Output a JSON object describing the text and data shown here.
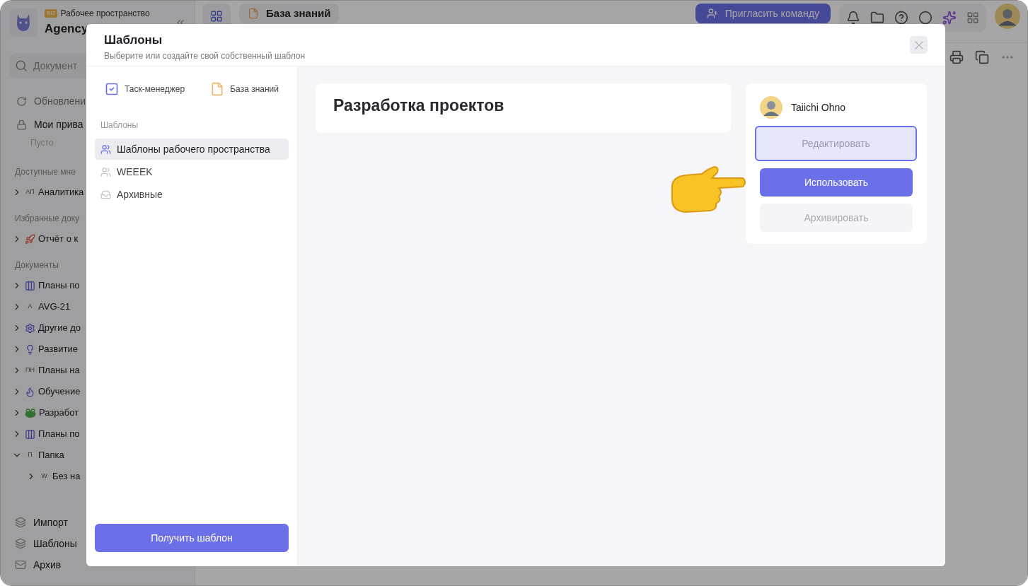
{
  "workspace": {
    "badge": "BIZ",
    "label": "Рабочее пространство",
    "name": "Agency"
  },
  "breadcrumb": {
    "title": "База знаний"
  },
  "invite_button": "Пригласить команду",
  "search": {
    "placeholder": "Документ"
  },
  "sidebar": {
    "top_items": [
      {
        "label": "Обновлени",
        "kind": "updates"
      },
      {
        "label": "Мои прива",
        "kind": "private"
      }
    ],
    "empty": "Пусто",
    "sections": [
      {
        "title": "Доступные мне",
        "items": [
          {
            "label": "Аналитика",
            "kind": "abbr",
            "abbr": "АП",
            "expanded": false
          }
        ]
      },
      {
        "title": "Избранные доку",
        "items": [
          {
            "label": "Отчёт о к",
            "kind": "rocket",
            "expanded": false
          }
        ]
      },
      {
        "title": "Документы",
        "items": [
          {
            "label": "Планы по",
            "kind": "board",
            "expanded": false
          },
          {
            "label": "AVG-21",
            "kind": "abbr",
            "abbr": "A",
            "expanded": false
          },
          {
            "label": "Другие до",
            "kind": "gear",
            "expanded": false
          },
          {
            "label": "Развитие",
            "kind": "bulb",
            "expanded": false
          },
          {
            "label": "Планы на",
            "kind": "abbr",
            "abbr": "ПН",
            "expanded": false
          },
          {
            "label": "Обучение",
            "kind": "flame",
            "expanded": false
          },
          {
            "label": "Разработ",
            "kind": "frog",
            "expanded": false
          },
          {
            "label": "Планы по",
            "kind": "board",
            "expanded": false
          },
          {
            "label": "Папка",
            "kind": "abbr",
            "abbr": "П",
            "expanded": true,
            "children": [
              {
                "label": "Без на",
                "kind": "abbr",
                "abbr": "W",
                "expanded": false
              }
            ]
          }
        ]
      }
    ],
    "bottom_items": [
      {
        "label": "Импорт",
        "kind": "import"
      },
      {
        "label": "Шаблоны",
        "kind": "import"
      },
      {
        "label": "Архив",
        "kind": "archive"
      }
    ]
  },
  "modal": {
    "title": "Шаблоны",
    "subtitle": "Выберите или создайте свой собственный шаблон",
    "sources": [
      {
        "label": "Таск-менеджер",
        "kind": "tasks"
      },
      {
        "label": "База знаний",
        "kind": "docs"
      }
    ],
    "section_title": "Шаблоны",
    "categories": [
      {
        "label": "Шаблоны рабочего пространства",
        "kind": "group",
        "selected": true
      },
      {
        "label": "WEEEK",
        "kind": "group",
        "selected": false
      },
      {
        "label": "Архивные",
        "kind": "archive",
        "selected": false
      }
    ],
    "get_button": "Получить шаблон",
    "template": {
      "title": "Разработка проектов",
      "author": "Taiichi Ohno",
      "actions": [
        {
          "label": "Редактировать",
          "kind": "focused"
        },
        {
          "label": "Использовать",
          "kind": "primary"
        },
        {
          "label": "Архивировать",
          "kind": "muted"
        }
      ]
    }
  }
}
